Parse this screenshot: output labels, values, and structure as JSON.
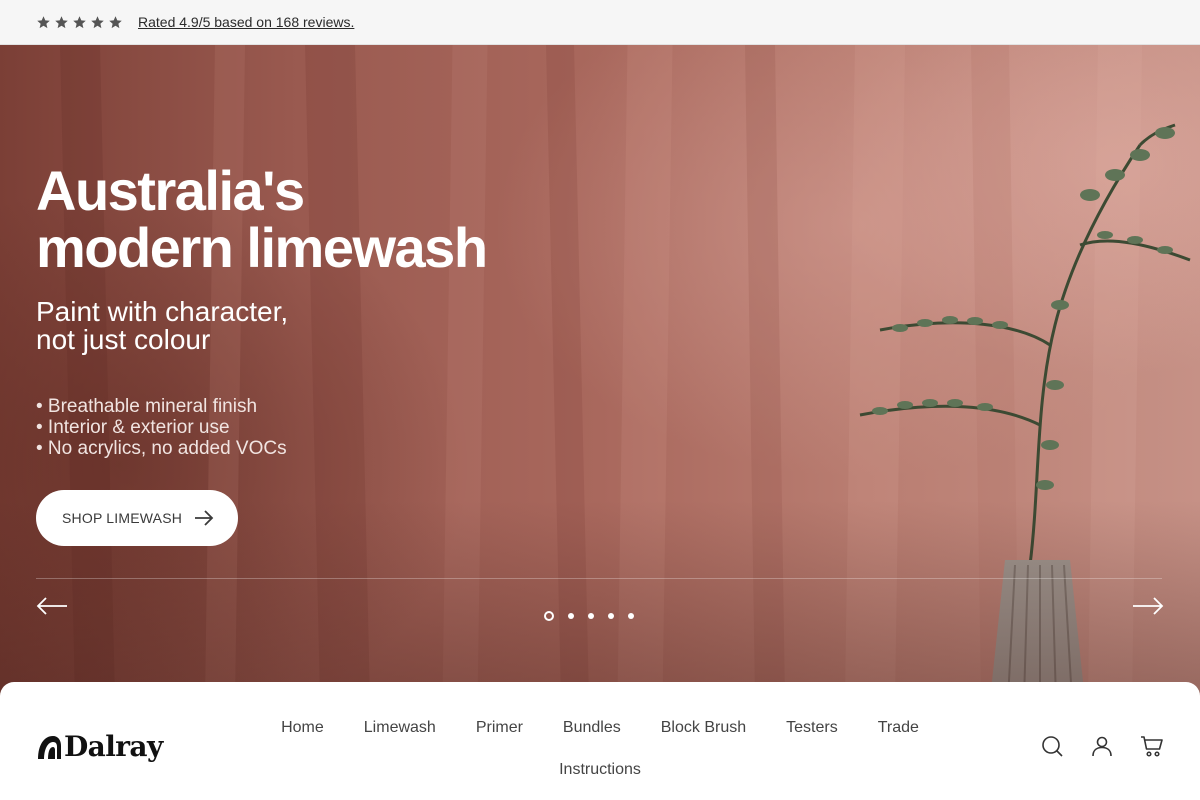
{
  "rating": {
    "stars": 5,
    "text": "Rated 4.9/5 based on 168 reviews.",
    "star_color": "#555555"
  },
  "hero": {
    "title_line1": "Australia's",
    "title_line2": "modern limewash",
    "subtitle_line1": "Paint with character,",
    "subtitle_line2": "not just colour",
    "bullets": [
      "• Breathable mineral finish",
      "• Interior & exterior use",
      "• No acrylics, no added VOCs"
    ],
    "cta_label": "SHOP LIMEWASH",
    "slides_total": 5,
    "active_slide": 1,
    "background_color": "#a9685d"
  },
  "nav": {
    "logo_text": "Dalray",
    "menu": [
      "Home",
      "Limewash",
      "Primer",
      "Bundles",
      "Block Brush",
      "Testers",
      "Trade",
      "Instructions"
    ],
    "icons": [
      "search-icon",
      "account-icon",
      "cart-icon"
    ]
  }
}
